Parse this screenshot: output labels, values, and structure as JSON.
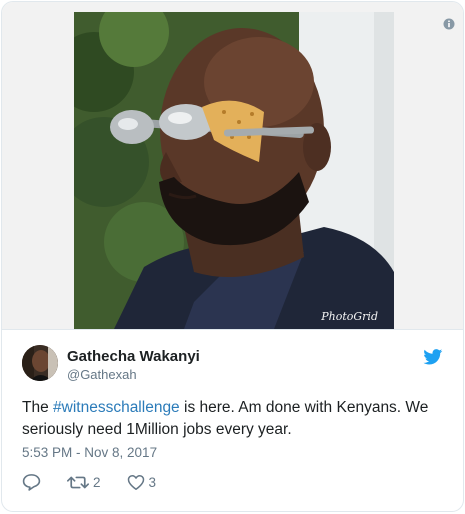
{
  "tweet": {
    "display_name": "Gathecha Wakanyi",
    "handle": "@Gathexah",
    "text_before": "The ",
    "hashtag": "#witnesschallenge",
    "text_after": " is here. Am done with Kenyans. We seriously need 1Million jobs every year.",
    "timestamp": "5:53 PM - Nov 8, 2017",
    "retweet_count": "2",
    "like_count": "3"
  },
  "media": {
    "watermark": "PhotoGrid"
  },
  "icons": {
    "info": "info-icon",
    "twitter": "twitter-bird-icon",
    "reply": "reply-icon",
    "retweet": "retweet-icon",
    "like": "heart-icon"
  },
  "colors": {
    "twitter_blue": "#1da1f2",
    "hashtag": "#2b7bb9",
    "muted": "#657786"
  }
}
